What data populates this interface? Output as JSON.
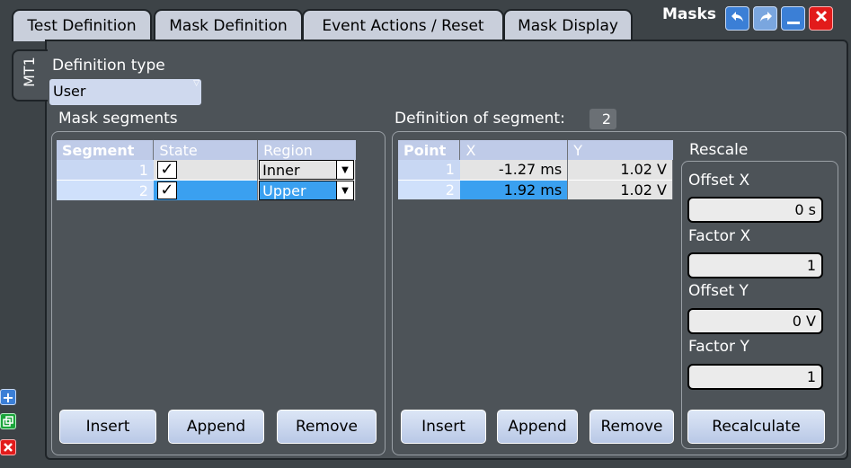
{
  "tabs": [
    "Test Definition",
    "Mask Definition",
    "Event Actions / Reset",
    "Mask Display"
  ],
  "window": {
    "title": "Masks"
  },
  "side_tab": "MT1",
  "definition_type": {
    "label": "Definition type",
    "value": "User"
  },
  "mask_segments": {
    "title": "Mask segments",
    "columns": [
      "Segment",
      "State",
      "Region"
    ],
    "rows": [
      {
        "segment": "1",
        "state_checked": true,
        "region": "Inner"
      },
      {
        "segment": "2",
        "state_checked": true,
        "region": "Upper"
      }
    ],
    "buttons": [
      "Insert",
      "Append",
      "Remove"
    ]
  },
  "segment_definition": {
    "title": "Definition of segment:",
    "segment_number": "2",
    "columns": [
      "Point",
      "X",
      "Y"
    ],
    "rows": [
      {
        "point": "1",
        "x": "-1.27 ms",
        "y": "1.02 V"
      },
      {
        "point": "2",
        "x": "1.92 ms",
        "y": "1.02 V"
      }
    ],
    "buttons": [
      "Insert",
      "Append",
      "Remove"
    ]
  },
  "rescale": {
    "title": "Rescale",
    "offset_x": {
      "label": "Offset X",
      "value": "0 s"
    },
    "factor_x": {
      "label": "Factor X",
      "value": "1"
    },
    "offset_y": {
      "label": "Offset Y",
      "value": "0 V"
    },
    "factor_y": {
      "label": "Factor Y",
      "value": "1"
    },
    "recalculate": "Recalculate"
  },
  "colors": {
    "background": "#3d4347",
    "panel": "#4d5358",
    "selection": "#3aa0f0",
    "table_header": "#bfcbe8"
  },
  "icons": [
    "undo-icon",
    "redo-icon",
    "minimize-icon",
    "close-icon",
    "add-icon",
    "copy-icon",
    "delete-icon",
    "check-icon",
    "dropdown-arrow-icon"
  ]
}
